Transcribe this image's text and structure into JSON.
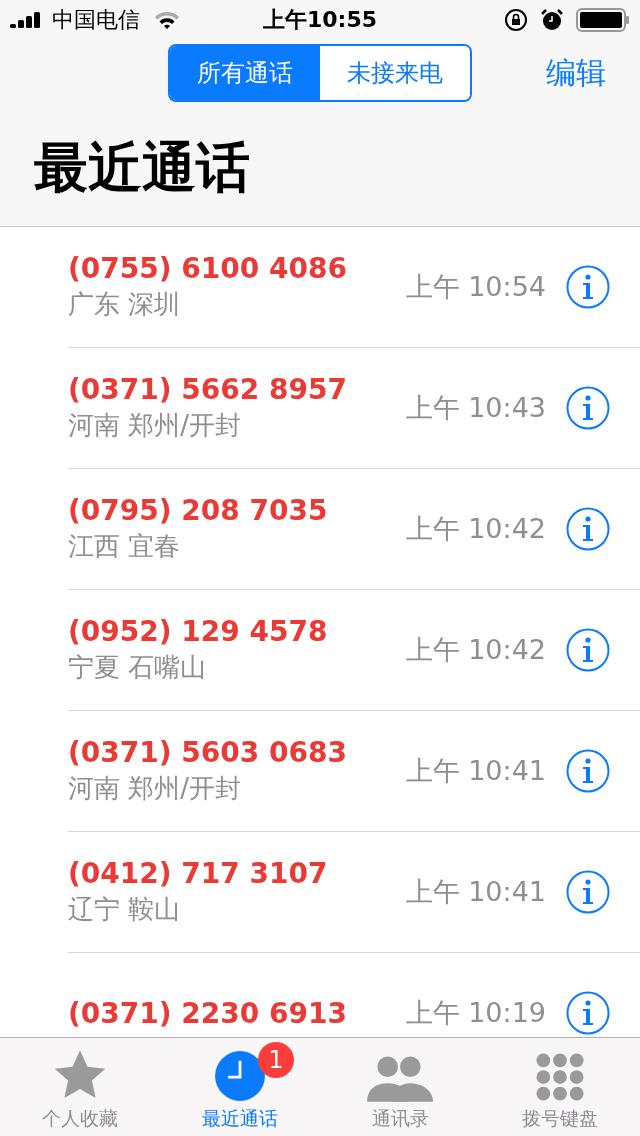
{
  "status_bar": {
    "carrier": "中国电信",
    "time": "上午10:55"
  },
  "segments": [
    {
      "label": "所有通话",
      "selected": true
    },
    {
      "label": "未接来电",
      "selected": false
    }
  ],
  "edit_button": "编辑",
  "title": "最近通话",
  "calls": [
    {
      "number": "(0755) 6100 4086",
      "location": "广东 深圳",
      "time": "上午 10:54",
      "missed": true
    },
    {
      "number": "(0371) 5662 8957",
      "location": "河南 郑州/开封",
      "time": "上午 10:43",
      "missed": true
    },
    {
      "number": "(0795) 208 7035",
      "location": "江西 宜春",
      "time": "上午 10:42",
      "missed": true
    },
    {
      "number": "(0952) 129 4578",
      "location": "宁夏 石嘴山",
      "time": "上午 10:42",
      "missed": true
    },
    {
      "number": "(0371) 5603 0683",
      "location": "河南 郑州/开封",
      "time": "上午 10:41",
      "missed": true
    },
    {
      "number": "(0412) 717 3107",
      "location": "辽宁 鞍山",
      "time": "上午 10:41",
      "missed": true
    },
    {
      "number": "(0371) 2230 6913",
      "time": "上午 10:19",
      "missed": true
    }
  ],
  "tab_bar": [
    {
      "kind": "star",
      "label": "个人收藏",
      "selected": false
    },
    {
      "kind": "clock",
      "label": "最近通话",
      "selected": true,
      "badge": "1"
    },
    {
      "kind": "contacts",
      "label": "通讯录",
      "selected": false
    },
    {
      "kind": "keypad",
      "label": "拨号键盘",
      "selected": false
    }
  ]
}
